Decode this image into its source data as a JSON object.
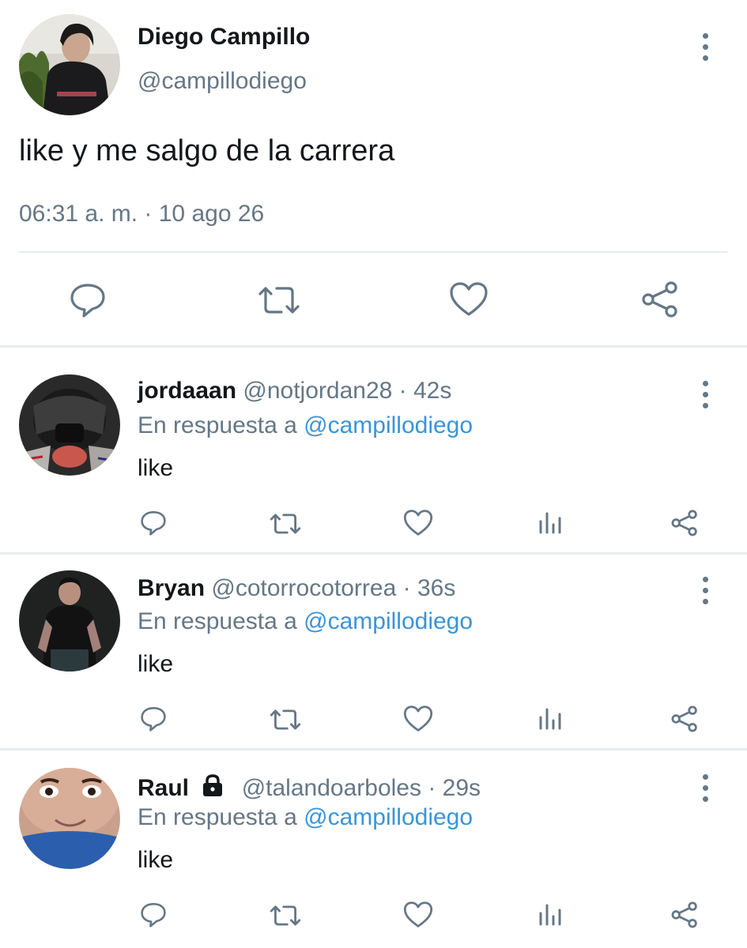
{
  "main_tweet": {
    "author_name": "Diego Campillo",
    "author_handle": "@campillodiego",
    "text": "like y me salgo de la carrera",
    "timestamp": "06:31 a. m. · 10 ago 26",
    "actions": [
      "reply-icon",
      "retweet-icon",
      "like-icon",
      "share-icon"
    ]
  },
  "replies": [
    {
      "name": "jordaaan",
      "handle": "@notjordan28",
      "time": "· 42s",
      "reply_label": "En respuesta a",
      "reply_mention": "@campillodiego",
      "text": "like",
      "locked": false
    },
    {
      "name": "Bryan",
      "handle": "@cotorrocotorrea",
      "time": "· 36s",
      "reply_label": "En respuesta a",
      "reply_mention": "@campillodiego",
      "text": "like",
      "locked": false
    },
    {
      "name": "Raul",
      "handle": "@talandoarboles",
      "time": "· 29s",
      "reply_label": "En respuesta a",
      "reply_mention": "@campillodiego",
      "text": "like",
      "locked": true
    }
  ],
  "colors": {
    "text": "#14171a",
    "secondary": "#657786",
    "mention": "#3b94d9",
    "divider": "#e6ecf0"
  }
}
